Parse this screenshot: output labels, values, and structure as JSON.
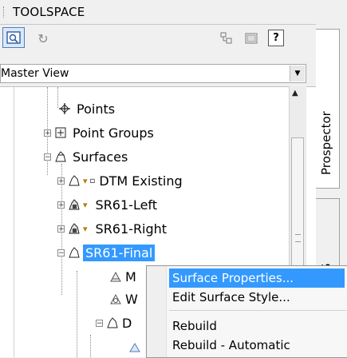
{
  "titlebar": {
    "title": "TOOLSPACE"
  },
  "toolbar": {
    "preview_icon": "preview-icon",
    "refresh_icon": "refresh-icon",
    "tb_icon_a": "item-view-icon",
    "tb_icon_b": "panel-icon",
    "help_label": "?"
  },
  "master_view": {
    "value": "Master View"
  },
  "tree": {
    "points": "Points",
    "point_groups": "Point Groups",
    "surfaces": "Surfaces",
    "dtm_existing": "DTM Existing",
    "sr61_left": "SR61-Left",
    "sr61_right": "SR61-Right",
    "sr61_final": "SR61-Final",
    "child_m": "M",
    "child_w": "W",
    "child_d": "D"
  },
  "tabs": {
    "prospector": "Prospector",
    "second": "S"
  },
  "context_menu": {
    "items": [
      "Surface Properties...",
      "Edit Surface Style...",
      "Rebuild",
      "Rebuild - Automatic"
    ]
  },
  "colors": {
    "selection": "#3399ff",
    "accent": "#4f7dbd"
  }
}
